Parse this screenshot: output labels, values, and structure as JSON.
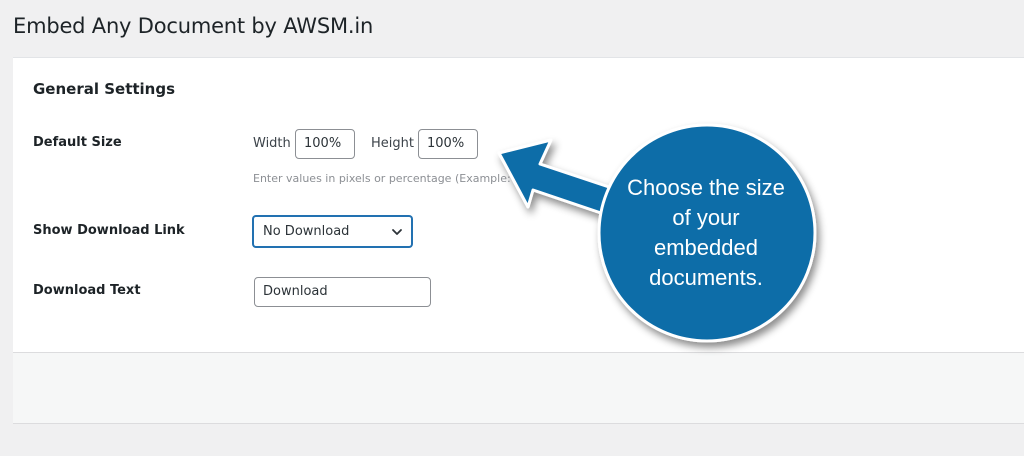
{
  "page": {
    "title": "Embed Any Document by AWSM.in"
  },
  "settings": {
    "section_title": "General Settings",
    "default_size": {
      "label": "Default Size",
      "width_label": "Width",
      "width_value": "100%",
      "height_label": "Height",
      "height_value": "100%",
      "hint": "Enter values in pixels or percentage (Example: 50"
    },
    "download_link": {
      "label": "Show Download Link",
      "selected": "No Download"
    },
    "download_text": {
      "label": "Download Text",
      "value": "Download"
    }
  },
  "callout": {
    "lines": [
      "Choose the size",
      "of your",
      "embedded",
      "documents."
    ],
    "color": "#0f6da8"
  },
  "colors": {
    "background": "#f0f0f1",
    "panel": "#ffffff",
    "focus_blue": "#2271b1"
  }
}
